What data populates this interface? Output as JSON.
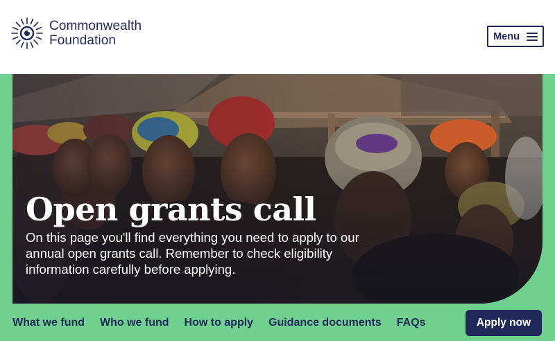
{
  "header": {
    "logo_line1": "Commonwealth",
    "logo_line2": "Foundation",
    "menu_label": "Menu"
  },
  "hero": {
    "title": "Open grants call",
    "subtitle": "On this page you'll find everything you need to apply to our annual open grants call. Remember to check eligibility information carefully before applying."
  },
  "nav": {
    "items": [
      "What we fund",
      "Who we fund",
      "How to apply",
      "Guidance documents",
      "FAQs"
    ],
    "cta": "Apply now"
  },
  "colors": {
    "navy": "#1f2a5a",
    "green": "#6fd08f",
    "white": "#ffffff"
  },
  "icons": {
    "logo": "sunburst-logo-icon",
    "menu": "hamburger-icon"
  }
}
